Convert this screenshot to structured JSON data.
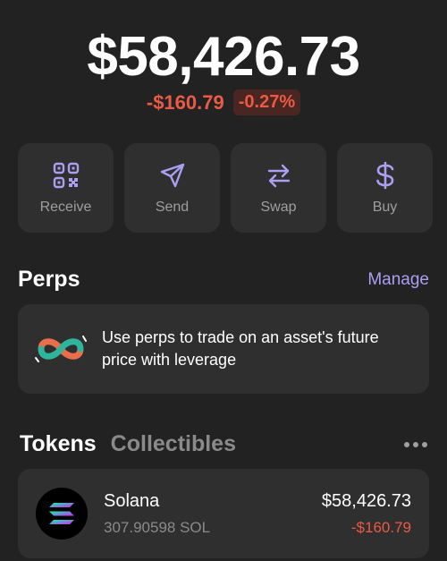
{
  "balance": {
    "total": "$58,426.73",
    "change_amount": "-$160.79",
    "change_percent": "-0.27%"
  },
  "actions": [
    {
      "label": "Receive",
      "icon": "qr-code-icon"
    },
    {
      "label": "Send",
      "icon": "send-icon"
    },
    {
      "label": "Swap",
      "icon": "swap-icon"
    },
    {
      "label": "Buy",
      "icon": "dollar-icon"
    }
  ],
  "perps": {
    "title": "Perps",
    "manage_label": "Manage",
    "promo_line1": "Use perps to trade on an asset's future",
    "promo_line2": "price with leverage"
  },
  "tabs": {
    "tokens": "Tokens",
    "collectibles": "Collectibles"
  },
  "tokens": [
    {
      "name": "Solana",
      "amount": "307.90598 SOL",
      "value": "$58,426.73",
      "change": "-$160.79"
    }
  ],
  "colors": {
    "accent": "#ab9ff2",
    "negative": "#eb5a45",
    "card": "#2f2f2f",
    "background": "#222222"
  }
}
